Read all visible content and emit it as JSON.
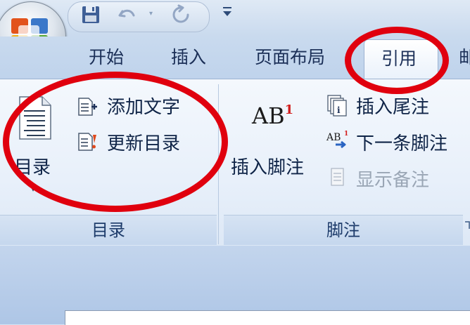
{
  "tabs": {
    "home": "开始",
    "insert": "插入",
    "page_layout": "页面布局",
    "references": "引用",
    "next_partial": "邮"
  },
  "toc_group": {
    "label": "目录",
    "toc_button": "目录",
    "add_text": "添加文字",
    "update_toc": "更新目录"
  },
  "footnote_group": {
    "label": "脚注",
    "insert_footnote": "插入脚注",
    "insert_endnote": "插入尾注",
    "next_footnote": "下一条脚注",
    "show_notes": "显示备注",
    "ab_text": "AB",
    "ab_superscript": "1"
  },
  "colors": {
    "annotation_red": "#e0000e",
    "tab_text": "#1b2f57",
    "ribbon_bg": "#e8f0fa"
  },
  "icons": [
    "office-logo-icon",
    "save-icon",
    "undo-icon",
    "redo-icon",
    "customize-qat-icon",
    "toc-document-icon",
    "add-text-icon",
    "update-toc-icon",
    "insert-endnote-icon",
    "next-footnote-icon",
    "show-notes-icon",
    "dialog-launcher-icon"
  ]
}
